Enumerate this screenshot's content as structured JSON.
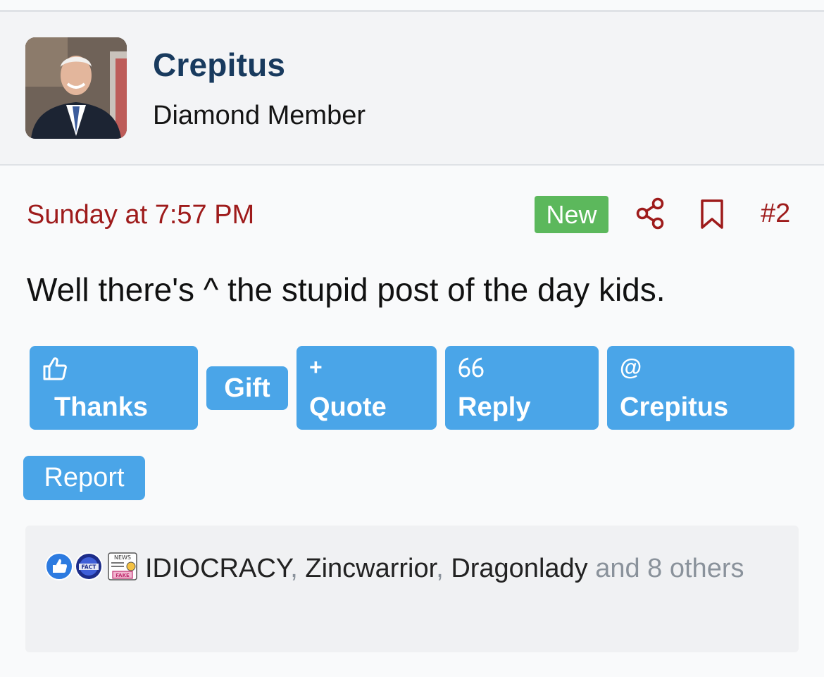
{
  "author": {
    "name": "Crepitus",
    "title": "Diamond Member",
    "avatar_icon": "user-avatar-photo"
  },
  "post": {
    "date": "Sunday at 7:57 PM",
    "badge": "New",
    "number": "#2",
    "share_icon": "share-icon",
    "bookmark_icon": "bookmark-icon",
    "body": "Well there's ^ the stupid post of the day kids."
  },
  "actions": {
    "thanks": {
      "icon": "👍",
      "label": "Thanks"
    },
    "gift": {
      "label": "Gift"
    },
    "quote": {
      "icon": "+",
      "label": "Quote"
    },
    "reply": {
      "icon": "66",
      "label": "Reply"
    },
    "mention": {
      "icon": "@",
      "label": "Crepitus"
    },
    "report": {
      "label": "Report"
    }
  },
  "reactions": {
    "icons": [
      "like-icon",
      "fact-icon",
      "fake-news-icon"
    ],
    "names": [
      "IDIOCRACY",
      "Zincwarrior",
      "Dragonlady"
    ],
    "separator": ", ",
    "suffix": " and 8 others"
  },
  "colors": {
    "accent_red": "#9e1b1b",
    "author_blue": "#183a5e",
    "button_blue": "#4aa5e8",
    "badge_green": "#5cb85c"
  }
}
